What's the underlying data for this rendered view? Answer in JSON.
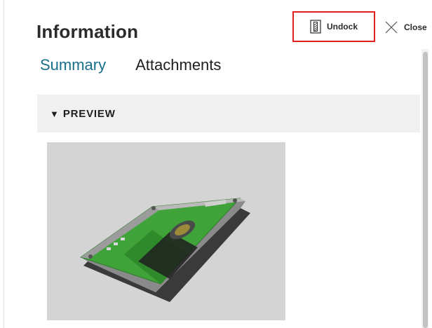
{
  "panel": {
    "title": "Information",
    "undock_label": "Undock",
    "close_label": "Close"
  },
  "tabs": [
    {
      "label": "Summary",
      "active": true
    },
    {
      "label": "Attachments",
      "active": false
    }
  ],
  "preview": {
    "caret_icon": "caret-down-icon",
    "label": "PREVIEW",
    "image_subject": "hard-drive-render"
  },
  "icons": {
    "undock": "undock-icon",
    "close": "close-icon"
  },
  "colors": {
    "active_tab": "#1a6e8a",
    "highlight_border": "#e02020",
    "section_header_bg": "#f0f0f0",
    "preview_bg": "#d4d4d4",
    "pcb_green": "#3fa33a"
  }
}
